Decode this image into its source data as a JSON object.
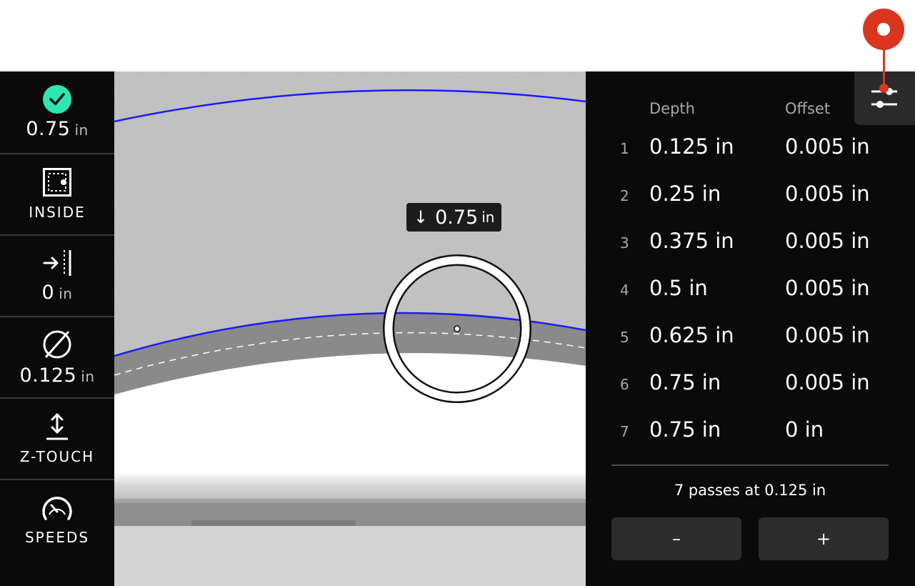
{
  "sidebar": {
    "depth": {
      "value": "0.75",
      "unit": "in",
      "icon": "check-circle-icon"
    },
    "cut_side": {
      "label": "INSIDE",
      "icon": "inside-cut-icon"
    },
    "offset": {
      "value": "0",
      "unit": "in",
      "icon": "offset-arrow-icon"
    },
    "bit": {
      "value": "0.125",
      "unit": "in",
      "icon": "diameter-icon"
    },
    "ztouch": {
      "label": "Z-TOUCH",
      "icon": "z-touch-icon"
    },
    "speeds": {
      "label": "SPEEDS",
      "icon": "gauge-icon"
    }
  },
  "canvas": {
    "depth_tag": {
      "arrow": "↓",
      "value": "0.75",
      "unit": "in"
    }
  },
  "panel": {
    "headers": {
      "depth": "Depth",
      "offset": "Offset"
    },
    "rows": [
      {
        "num": "1",
        "depth": "0.125 in",
        "offset": "0.005 in"
      },
      {
        "num": "2",
        "depth": "0.25 in",
        "offset": "0.005 in"
      },
      {
        "num": "3",
        "depth": "0.375 in",
        "offset": "0.005 in"
      },
      {
        "num": "4",
        "depth": "0.5 in",
        "offset": "0.005 in"
      },
      {
        "num": "5",
        "depth": "0.625 in",
        "offset": "0.005 in"
      },
      {
        "num": "6",
        "depth": "0.75 in",
        "offset": "0.005 in"
      },
      {
        "num": "7",
        "depth": "0.75 in",
        "offset": "0 in"
      }
    ],
    "summary": "7 passes at 0.125 in",
    "minus_label": "–",
    "plus_label": "+",
    "settings_icon": "sliders-icon"
  },
  "colors": {
    "accent_check": "#2ee6b4",
    "toolpath_blue": "#1a1aff",
    "annotation_red": "#d9351f"
  }
}
